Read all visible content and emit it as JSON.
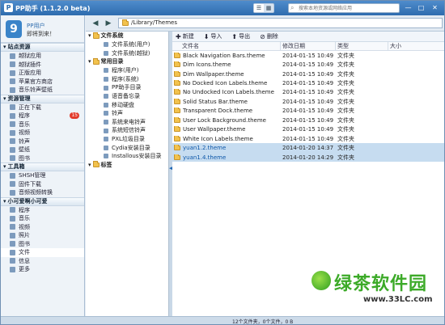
{
  "app": {
    "title": "PP助手 (1.1.2.0  beta)",
    "logo_glyph": "P"
  },
  "titlebar": {
    "view_icons": [
      "list-view-icon",
      "grid-view-icon"
    ],
    "view_glyphs": [
      "☰",
      "▦"
    ],
    "search_placeholder": "搜索本地资源或网络应用",
    "search_glyph": "⌕",
    "window_controls": [
      "—",
      "□",
      "✕"
    ]
  },
  "user": {
    "avatar_glyph": "9",
    "name": "PP用户",
    "status": "即将到来！"
  },
  "sidebar": {
    "sections": [
      {
        "title": "站点资源",
        "items": [
          {
            "label": "越狱应用"
          },
          {
            "label": "越狱插件"
          },
          {
            "label": "正版应用"
          },
          {
            "label": "苹果官方商店"
          },
          {
            "label": "音乐铃声壁纸"
          }
        ]
      },
      {
        "title": "资源管理",
        "items": [
          {
            "label": "正在下载"
          },
          {
            "label": "程序",
            "badge": "15"
          },
          {
            "label": "音乐"
          },
          {
            "label": "视频"
          },
          {
            "label": "铃声"
          },
          {
            "label": "壁纸"
          },
          {
            "label": "图书"
          }
        ]
      },
      {
        "title": "工具箱",
        "items": [
          {
            "label": "SHSH管理"
          },
          {
            "label": "固件下载"
          },
          {
            "label": "音频视频转换"
          }
        ]
      },
      {
        "title": "小可爱啊小可爱",
        "items": [
          {
            "label": "程序"
          },
          {
            "label": "音乐"
          },
          {
            "label": "视频"
          },
          {
            "label": "照片"
          },
          {
            "label": "图书"
          },
          {
            "label": "文件",
            "selected": true
          },
          {
            "label": "信息"
          },
          {
            "label": "更多"
          }
        ]
      }
    ]
  },
  "nav": {
    "back": "◀",
    "forward": "▶",
    "path": "/Library/Themes"
  },
  "tree": {
    "groups": [
      {
        "title": "文件系统",
        "items": [
          "文件系统(用户)",
          "文件系统(越狱)"
        ]
      },
      {
        "title": "常用目录",
        "items": [
          "程序(用户)",
          "程序(系统)",
          "PP助手目录",
          "语音备忘录",
          "移动硬盘",
          "铃声",
          "系统来电铃声",
          "系统短信铃声",
          "PXL垃圾目录",
          "Cydia安装目录",
          "Installous安装目录"
        ]
      },
      {
        "title": "标签",
        "items": []
      }
    ],
    "splitter_glyph": "◀"
  },
  "toolbar": [
    {
      "icon": "new-icon",
      "glyph": "✚",
      "label": "新建"
    },
    {
      "icon": "import-icon",
      "glyph": "⬇",
      "label": "导入"
    },
    {
      "icon": "export-icon",
      "glyph": "⬆",
      "label": "导出"
    },
    {
      "icon": "delete-icon",
      "glyph": "⊘",
      "label": "删除"
    }
  ],
  "columns": {
    "name": "文件名",
    "date": "修改日期",
    "type": "类型",
    "size": "大小"
  },
  "files": [
    {
      "name": "Black Navigation Bars.theme",
      "date": "2014-01-15 10:49",
      "type": "文件夹"
    },
    {
      "name": "Dim Icons.theme",
      "date": "2014-01-15 10:49",
      "type": "文件夹"
    },
    {
      "name": "Dim Wallpaper.theme",
      "date": "2014-01-15 10:49",
      "type": "文件夹"
    },
    {
      "name": "No Docked Icon Labels.theme",
      "date": "2014-01-15 10:49",
      "type": "文件夹"
    },
    {
      "name": "No Undocked Icon Labels.theme",
      "date": "2014-01-15 10:49",
      "type": "文件夹"
    },
    {
      "name": "Solid Status Bar.theme",
      "date": "2014-01-15 10:49",
      "type": "文件夹"
    },
    {
      "name": "Transparent Dock.theme",
      "date": "2014-01-15 10:49",
      "type": "文件夹"
    },
    {
      "name": "User Lock Background.theme",
      "date": "2014-01-15 10:49",
      "type": "文件夹"
    },
    {
      "name": "User Wallpaper.theme",
      "date": "2014-01-15 10:49",
      "type": "文件夹"
    },
    {
      "name": "White Icon Labels.theme",
      "date": "2014-01-15 10:49",
      "type": "文件夹"
    },
    {
      "name": "yuan1.2.theme",
      "date": "2014-01-20 14:37",
      "type": "文件夹",
      "selected": true
    },
    {
      "name": "yuan1.4.theme",
      "date": "2014-01-20 14:29",
      "type": "文件夹",
      "selected": true
    }
  ],
  "status": "12个文件夹，0个文件，0 B",
  "watermark": {
    "title": "绿茶软件园",
    "url": "www.33LC.com"
  },
  "colors": {
    "accent": "#2e6cae",
    "selection": "#c6dcf0",
    "badge": "#e23b2c",
    "folder": "#f2c24d"
  }
}
